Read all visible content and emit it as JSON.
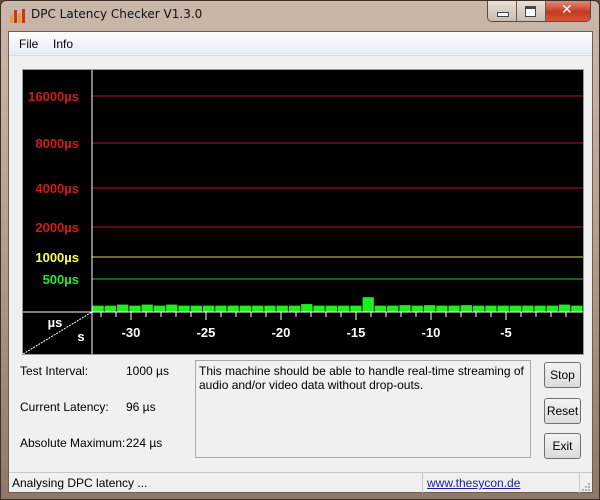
{
  "window": {
    "title": "DPC Latency Checker V1.3.0",
    "controls": [
      "minimize",
      "maximize",
      "close"
    ]
  },
  "menu": {
    "items": [
      {
        "label": "File"
      },
      {
        "label": "Info"
      }
    ]
  },
  "chart_data": {
    "type": "bar",
    "title": "",
    "xlabel": "s",
    "ylabel": "µs",
    "y_scale": "log2-like",
    "y_levels": [
      {
        "label": "16000µs",
        "value": 16000,
        "color": "#d21a1a"
      },
      {
        "label": "8000µs",
        "value": 8000,
        "color": "#d21a1a"
      },
      {
        "label": "4000µs",
        "value": 4000,
        "color": "#d21a1a"
      },
      {
        "label": "2000µs",
        "value": 2000,
        "color": "#d21a1a"
      },
      {
        "label": "1000µs",
        "value": 1000,
        "color": "#ffff50"
      },
      {
        "label": "500µs",
        "value": 500,
        "color": "#2ee62e"
      }
    ],
    "x_ticks": [
      "-30",
      "-25",
      "-20",
      "-15",
      "-10",
      "-5"
    ],
    "x_range": [
      -32.5,
      0
    ],
    "bar_color": "#1ef01e",
    "values": [
      96,
      96,
      112,
      96,
      112,
      96,
      112,
      96,
      96,
      96,
      96,
      96,
      96,
      96,
      96,
      96,
      96,
      120,
      96,
      96,
      96,
      96,
      224,
      96,
      96,
      104,
      96,
      104,
      96,
      96,
      104,
      96,
      96,
      96,
      96,
      96,
      96,
      96,
      112,
      96
    ],
    "grid": true,
    "legend": "none"
  },
  "stats": {
    "test_interval_label": "Test Interval:",
    "test_interval_value": "1000 µs",
    "current_latency_label": "Current Latency:",
    "current_latency_value": "96 µs",
    "absolute_maximum_label": "Absolute Maximum:",
    "absolute_maximum_value": "224 µs"
  },
  "message": "This machine should be able to handle real-time streaming of audio and/or video data without drop-outs.",
  "buttons": {
    "stop": "Stop",
    "reset": "Reset",
    "exit": "Exit"
  },
  "statusbar": {
    "text": "Analysing DPC latency ...",
    "link": "www.thesycon.de"
  },
  "axis_corner": {
    "y_unit": "µs",
    "x_unit": "s"
  }
}
